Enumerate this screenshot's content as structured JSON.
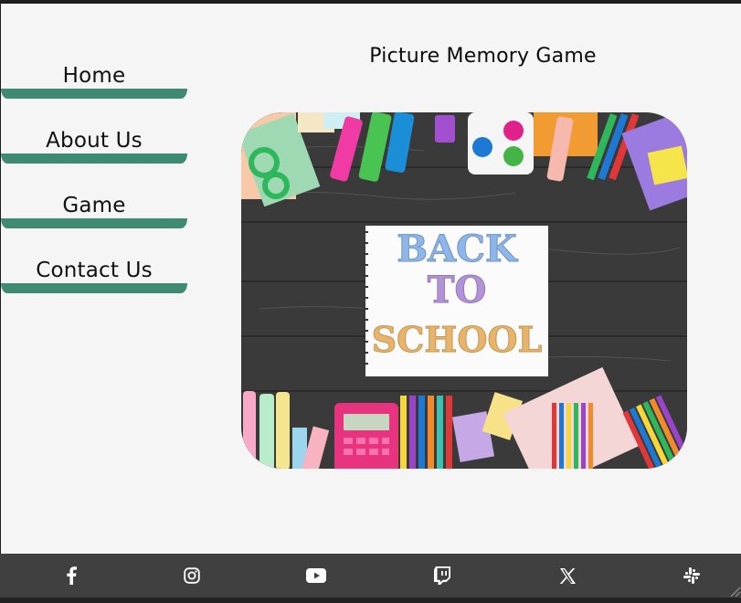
{
  "nav": {
    "items": [
      {
        "label": "Home"
      },
      {
        "label": "About Us"
      },
      {
        "label": "Game"
      },
      {
        "label": "Contact Us"
      }
    ]
  },
  "main": {
    "title": "Picture Memory Game",
    "hero_text": [
      "BACK",
      "TO",
      "SCHOOL"
    ]
  },
  "footer": {
    "icons": [
      "facebook-icon",
      "instagram-icon",
      "youtube-icon",
      "twitch-icon",
      "x-icon",
      "slack-icon"
    ]
  },
  "colors": {
    "accent": "#3e8a72",
    "footer": "#404040",
    "page": "#f5f5f5"
  }
}
